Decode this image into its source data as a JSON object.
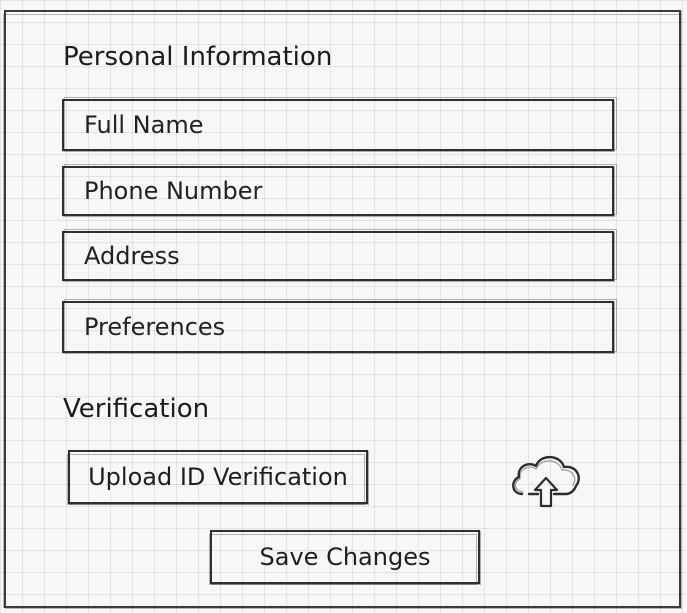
{
  "personal_info": {
    "heading": "Personal Information",
    "fields": [
      {
        "placeholder": "Full Name"
      },
      {
        "placeholder": "Phone Number"
      },
      {
        "placeholder": "Address"
      },
      {
        "placeholder": "Preferences"
      }
    ]
  },
  "verification": {
    "heading": "Verification",
    "upload_label": "Upload ID Verification",
    "icon": "cloud-upload-icon"
  },
  "actions": {
    "save_label": "Save Changes"
  }
}
